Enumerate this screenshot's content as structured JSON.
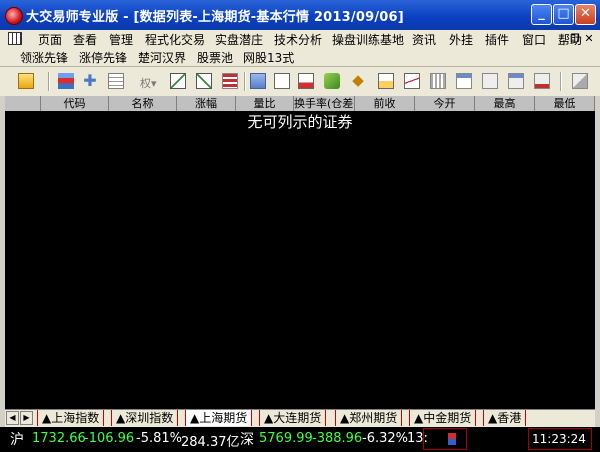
{
  "window": {
    "title": "大交易师专业版 - [数据列表-上海期货-基本行情 2013/09/06]"
  },
  "menu": [
    "页面",
    "查看",
    "管理",
    "程式化交易",
    "实盘潜庄",
    "技术分析",
    "操盘训练基地",
    "资讯",
    "外挂",
    "插件",
    "窗口",
    "帮助"
  ],
  "quick_menu": [
    "领涨先锋",
    "涨停先锋",
    "楚河汉界",
    "股票池",
    "网股13式"
  ],
  "toolbar": {
    "quan_label": "权▾"
  },
  "columns": [
    "代码",
    "名称",
    "涨幅",
    "量比",
    "换手率(仓差)",
    "前收",
    "今开",
    "最高",
    "最低"
  ],
  "empty_message": "无可列示的证券",
  "tabs": [
    "▲上海指数",
    "▲深圳指数",
    "▲上海期货",
    "▲大连期货",
    "▲郑州期货",
    "▲中金期货",
    "▲香港"
  ],
  "active_tab": 2,
  "status": {
    "sh_label": "沪",
    "sh_index": "1732.66",
    "sh_change": "-106.96",
    "sh_pct": "-5.81%",
    "sh_amount": "284.37亿",
    "sz_label": "深",
    "sz_index": "5769.99",
    "sz_change": "-388.96",
    "sz_pct": "-6.32%",
    "sz_amount": "13:",
    "time": "11:23:24"
  }
}
